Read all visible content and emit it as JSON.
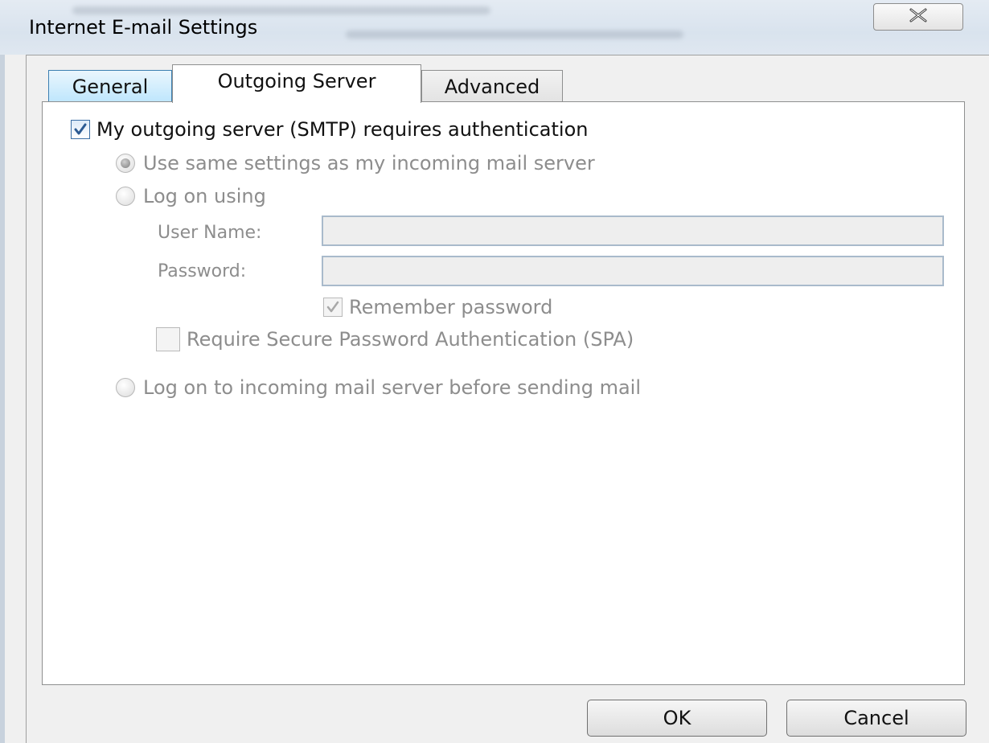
{
  "window": {
    "title": "Internet E-mail Settings",
    "close_icon": "close-icon"
  },
  "tabs": [
    {
      "label": "General",
      "selected": false
    },
    {
      "label": "Outgoing Server",
      "selected": true
    },
    {
      "label": "Advanced",
      "selected": false
    }
  ],
  "outgoing": {
    "requires_auth": {
      "label": "My outgoing server (SMTP) requires authentication",
      "checked": true
    },
    "use_same": {
      "label": "Use same settings as my incoming mail server",
      "selected": true
    },
    "log_on_using": {
      "label": "Log on using",
      "selected": false
    },
    "user_name": {
      "label": "User Name:",
      "value": ""
    },
    "password": {
      "label": "Password:",
      "value": ""
    },
    "remember_password": {
      "label": "Remember password",
      "checked": true
    },
    "require_spa": {
      "label": "Require Secure Password Authentication (SPA)",
      "checked": false
    },
    "log_on_incoming": {
      "label": "Log on to incoming mail server before sending mail",
      "selected": false
    }
  },
  "buttons": {
    "ok": "OK",
    "cancel": "Cancel"
  },
  "colors": {
    "check_accent": "#3a6ea5",
    "selected_tab_bg": "#ffffff",
    "inactive_tab_bg": "#bee6fd",
    "disabled_text": "#8d8d8d"
  }
}
